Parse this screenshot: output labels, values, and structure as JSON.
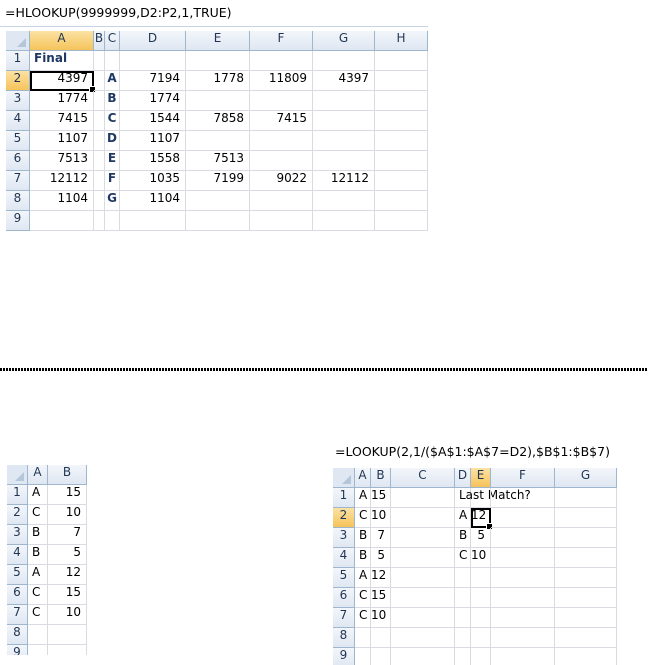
{
  "sheet1": {
    "formula": "=HLOOKUP(9999999,D2:P2,1,TRUE)",
    "columns": [
      "A",
      "B",
      "C",
      "D",
      "E",
      "F",
      "G",
      "H"
    ],
    "rows": [
      {
        "num": "1",
        "a": "Final",
        "b": "",
        "c": "",
        "d": "",
        "e": "",
        "f": "",
        "g": "",
        "h": ""
      },
      {
        "num": "2",
        "a": "4397",
        "b": "",
        "c": "A",
        "d": "7194",
        "e": "1778",
        "f": "11809",
        "g": "4397",
        "h": ""
      },
      {
        "num": "3",
        "a": "1774",
        "b": "",
        "c": "B",
        "d": "1774",
        "e": "",
        "f": "",
        "g": "",
        "h": ""
      },
      {
        "num": "4",
        "a": "7415",
        "b": "",
        "c": "C",
        "d": "1544",
        "e": "7858",
        "f": "7415",
        "g": "",
        "h": ""
      },
      {
        "num": "5",
        "a": "1107",
        "b": "",
        "c": "D",
        "d": "1107",
        "e": "",
        "f": "",
        "g": "",
        "h": ""
      },
      {
        "num": "6",
        "a": "7513",
        "b": "",
        "c": "E",
        "d": "1558",
        "e": "7513",
        "f": "",
        "g": "",
        "h": ""
      },
      {
        "num": "7",
        "a": "12112",
        "b": "",
        "c": "F",
        "d": "1035",
        "e": "7199",
        "f": "9022",
        "g": "12112",
        "h": ""
      },
      {
        "num": "8",
        "a": "1104",
        "b": "",
        "c": "G",
        "d": "1104",
        "e": "",
        "f": "",
        "g": "",
        "h": ""
      },
      {
        "num": "9",
        "a": "",
        "b": "",
        "c": "",
        "d": "",
        "e": "",
        "f": "",
        "g": "",
        "h": ""
      }
    ]
  },
  "sheet2": {
    "columns": [
      "A",
      "B"
    ],
    "rows": [
      {
        "num": "1",
        "a": "A",
        "b": "15"
      },
      {
        "num": "2",
        "a": "C",
        "b": "10"
      },
      {
        "num": "3",
        "a": "B",
        "b": "7"
      },
      {
        "num": "4",
        "a": "B",
        "b": "5"
      },
      {
        "num": "5",
        "a": "A",
        "b": "12"
      },
      {
        "num": "6",
        "a": "C",
        "b": "15"
      },
      {
        "num": "7",
        "a": "C",
        "b": "10"
      },
      {
        "num": "8",
        "a": "",
        "b": ""
      },
      {
        "num": "9",
        "a": "",
        "b": ""
      }
    ]
  },
  "sheet3": {
    "formula": "=LOOKUP(2,1/($A$1:$A$7=D2),$B$1:$B$7)",
    "columns": [
      "A",
      "B",
      "C",
      "D",
      "E",
      "F",
      "G"
    ],
    "rows": [
      {
        "num": "1",
        "a": "A",
        "b": "15",
        "c": "",
        "d": "Last Match?",
        "e": "",
        "f": "",
        "g": ""
      },
      {
        "num": "2",
        "a": "C",
        "b": "10",
        "c": "",
        "d": "A",
        "e": "12",
        "f": "",
        "g": ""
      },
      {
        "num": "3",
        "a": "B",
        "b": "7",
        "c": "",
        "d": "B",
        "e": "5",
        "f": "",
        "g": ""
      },
      {
        "num": "4",
        "a": "B",
        "b": "5",
        "c": "",
        "d": "C",
        "e": "10",
        "f": "",
        "g": ""
      },
      {
        "num": "5",
        "a": "A",
        "b": "12",
        "c": "",
        "d": "",
        "e": "",
        "f": "",
        "g": ""
      },
      {
        "num": "6",
        "a": "C",
        "b": "15",
        "c": "",
        "d": "",
        "e": "",
        "f": "",
        "g": ""
      },
      {
        "num": "7",
        "a": "C",
        "b": "10",
        "c": "",
        "d": "",
        "e": "",
        "f": "",
        "g": ""
      },
      {
        "num": "8",
        "a": "",
        "b": "",
        "c": "",
        "d": "",
        "e": "",
        "f": "",
        "g": ""
      },
      {
        "num": "9",
        "a": "",
        "b": "",
        "c": "",
        "d": "",
        "e": "",
        "f": "",
        "g": ""
      }
    ]
  }
}
